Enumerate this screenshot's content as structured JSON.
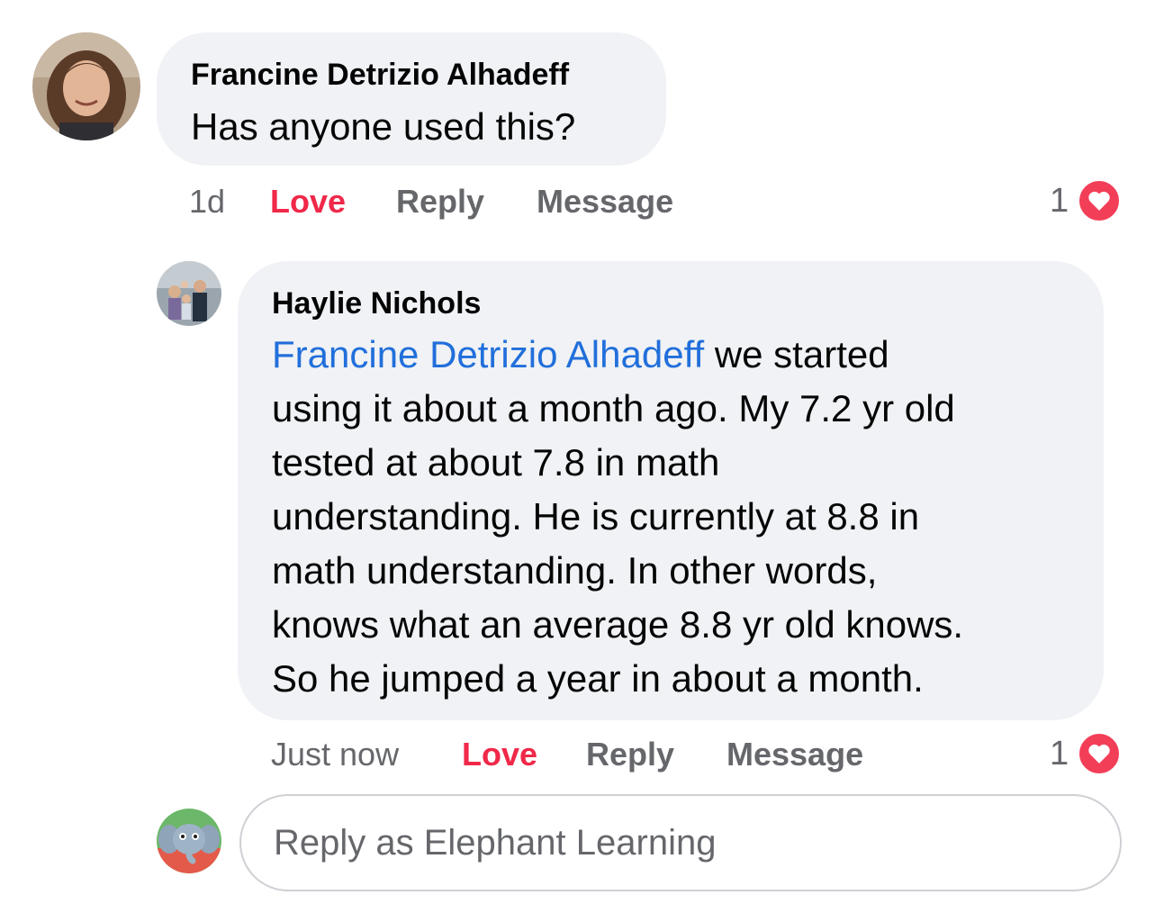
{
  "comments": [
    {
      "author": "Francine Detrizio Alhadeff",
      "text": "Has anyone used this?",
      "time": "1d",
      "love_label": "Love",
      "reply_label": "Reply",
      "message_label": "Message",
      "reaction_count": "1",
      "reaction_icon": "heart-icon"
    },
    {
      "author": "Haylie Nichols",
      "mention": "Francine Detrizio Alhadeff",
      "text_line1_rest": " we started",
      "text_lines": [
        "using it about a month ago. My 7.2 yr old",
        "tested at about 7.8 in math",
        "understanding. He is currently at 8.8 in",
        "math understanding. In other words,",
        "knows what an average 8.8 yr old knows.",
        "So he jumped a year in about a month."
      ],
      "time": "Just now",
      "love_label": "Love",
      "reply_label": "Reply",
      "message_label": "Message",
      "reaction_count": "1",
      "reaction_icon": "heart-icon"
    }
  ],
  "reply_composer": {
    "placeholder": "Reply as Elephant Learning",
    "avatar_icon": "elephant-icon"
  },
  "colors": {
    "link": "#216fdb",
    "love": "#f02849",
    "meta": "#65676b",
    "bubble": "#f0f2f5",
    "heart_badge": "#f33e58"
  }
}
